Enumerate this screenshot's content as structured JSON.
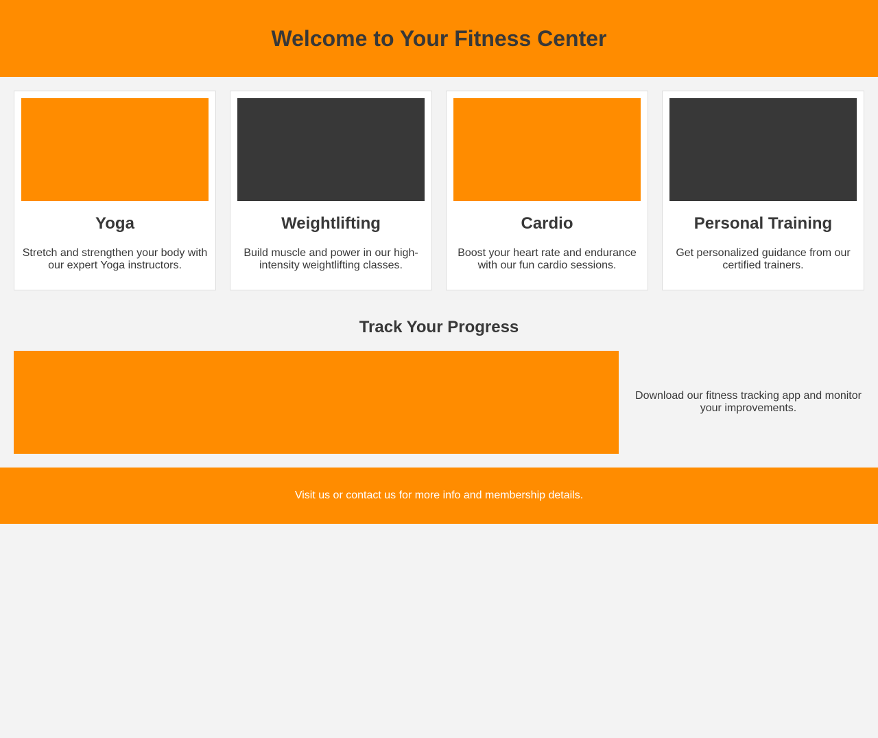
{
  "header": {
    "title": "Welcome to Your Fitness Center"
  },
  "colors": {
    "accent": "#ff8c00",
    "dark": "#383838",
    "background": "#f3f3f3"
  },
  "services": [
    {
      "title": "Yoga",
      "description": "Stretch and strengthen your body with our expert Yoga instructors.",
      "image_color": "#ff8c00"
    },
    {
      "title": "Weightlifting",
      "description": "Build muscle and power in our high-intensity weightlifting classes.",
      "image_color": "#383838"
    },
    {
      "title": "Cardio",
      "description": "Boost your heart rate and endurance with our fun cardio sessions.",
      "image_color": "#ff8c00"
    },
    {
      "title": "Personal Training",
      "description": "Get personalized guidance from our certified trainers.",
      "image_color": "#383838"
    }
  ],
  "progress": {
    "title": "Track Your Progress",
    "description": "Download our fitness tracking app and monitor your improvements.",
    "image_color": "#ff8c00"
  },
  "footer": {
    "text": "Visit us or contact us for more info and membership details."
  }
}
